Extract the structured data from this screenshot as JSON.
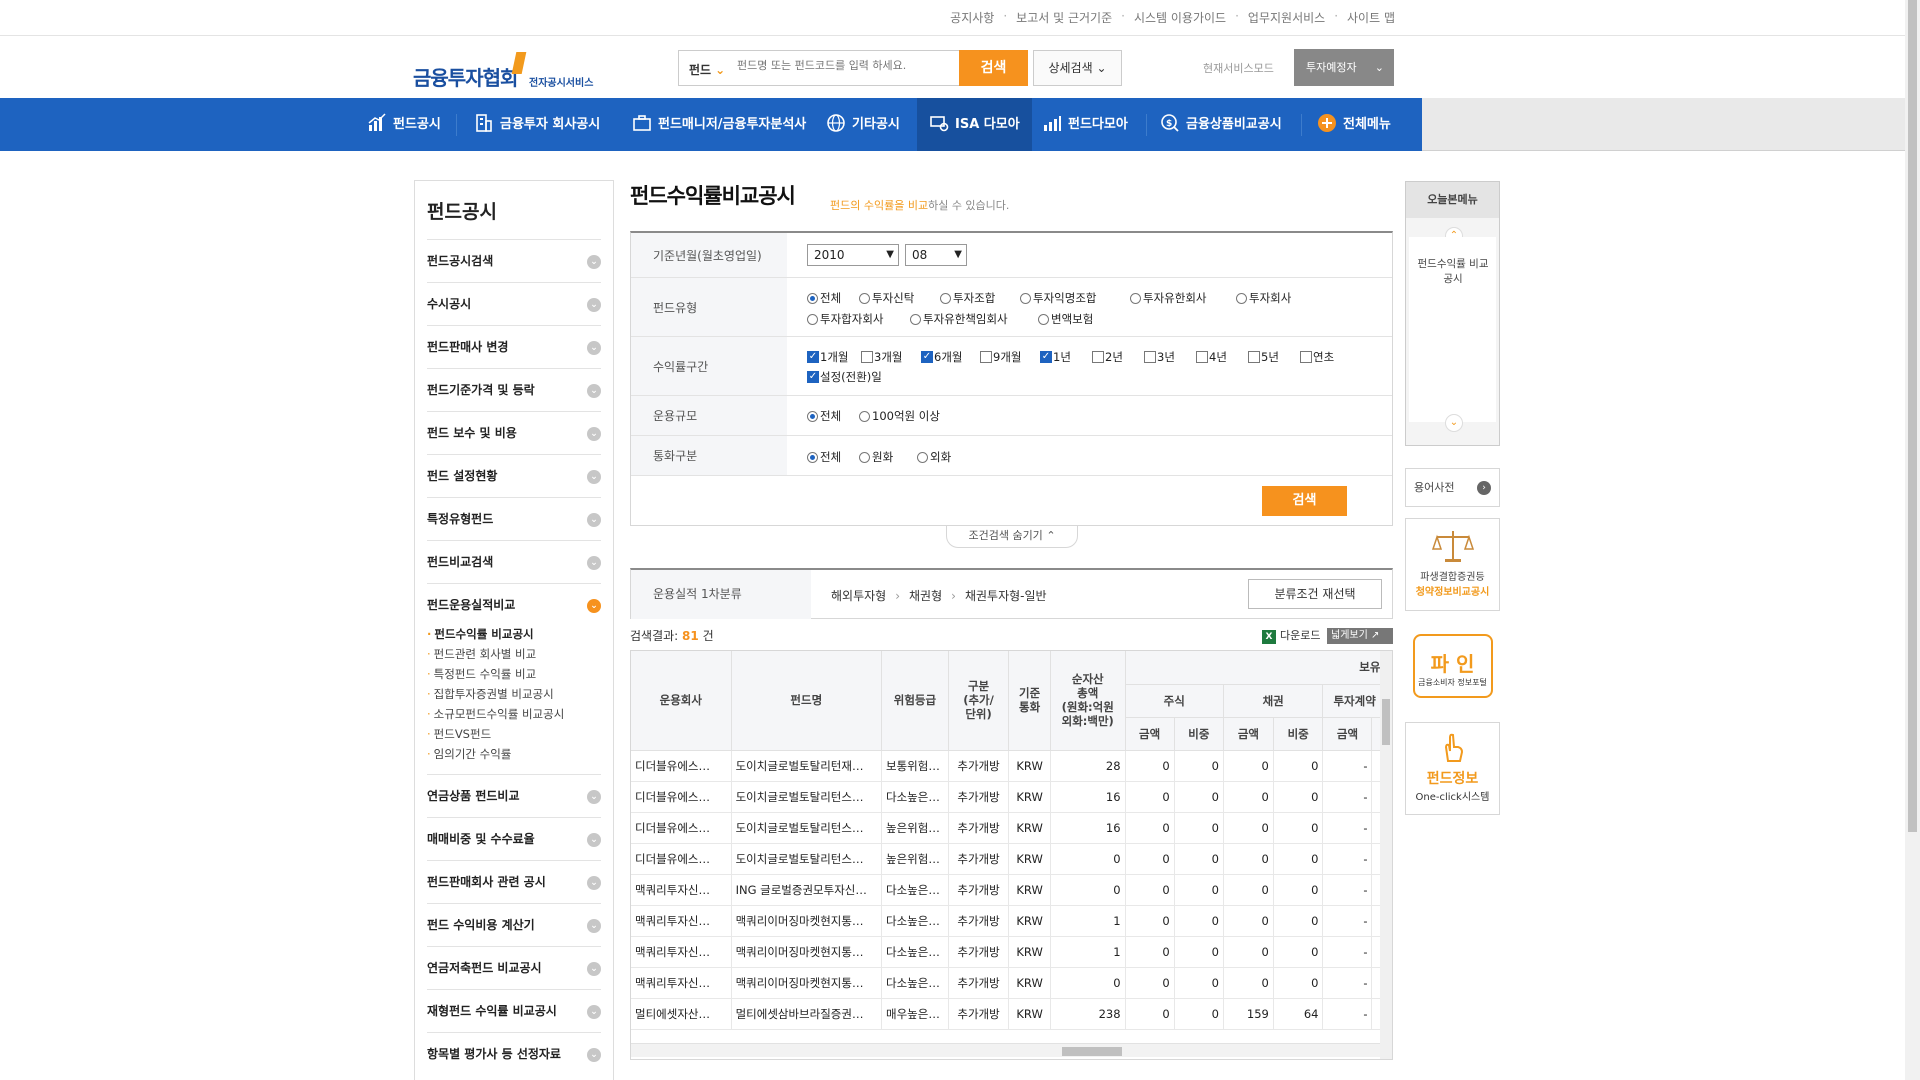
{
  "top_links": [
    "공지사항",
    "보고서 및 근거기준",
    "시스템 이용가이드",
    "업무지원서비스",
    "사이트 맵"
  ],
  "logo": {
    "title": "금융투자협회",
    "subtitle": "전자공시서비스"
  },
  "search": {
    "category": "펀드",
    "placeholder": "펀드명 또는 펀드코드를 입력 하세요.",
    "button": "검색",
    "detail": "상세검색"
  },
  "service_mode": {
    "label": "현재서비스모드",
    "value": "투자예정자"
  },
  "nav": [
    "펀드공시",
    "금융투자 회사공시",
    "펀드매니저/금융투자분석사",
    "기타공시",
    "ISA 다모아",
    "펀드다모아",
    "금융상품비교공시",
    "전체메뉴"
  ],
  "sidebar": {
    "title": "펀드공시",
    "items": [
      "펀드공시검색",
      "수시공시",
      "펀드판매사 변경",
      "펀드기준가격 및 등락",
      "펀드 보수 및 비용",
      "펀드 설정현황",
      "특정유형펀드",
      "펀드비교검색",
      "펀드운용실적비교",
      "연금상품 펀드비교",
      "매매비중 및 수수료율",
      "펀드판매회사 관련 공시",
      "펀드 수익비용 계산기",
      "연금저축펀드 비교공시",
      "재형펀드 수익률 비교공시",
      "항목별 평가사 등 선정자료"
    ],
    "sub_items": [
      "펀드수익률 비교공시",
      "펀드관련 회사별 비교",
      "특정펀드 수익률 비교",
      "집합투자증권별 비교공시",
      "소규모펀드수익률 비교공시",
      "펀드VS펀드",
      "임의기간 수익률"
    ]
  },
  "page": {
    "title": "펀드수익률비교공시",
    "subtitle_hl": "펀드의 수익률을 비교",
    "subtitle_rest": "하실 수 있습니다."
  },
  "form": {
    "base_date_label": "기준년월(월초영업일)",
    "year": "2010",
    "month": "08",
    "fund_type_label": "펀드유형",
    "fund_types": [
      "전체",
      "투자신탁",
      "투자조합",
      "투자익명조합",
      "투자유한회사",
      "투자회사",
      "투자합자회사",
      "투자유한책임회사",
      "변액보험"
    ],
    "period_label": "수익률구간",
    "periods": [
      "1개월",
      "3개월",
      "6개월",
      "9개월",
      "1년",
      "2년",
      "3년",
      "4년",
      "5년",
      "연초",
      "설정(전환)일"
    ],
    "size_label": "운용규모",
    "sizes": [
      "전체",
      "100억원 이상"
    ],
    "currency_label": "통화구분",
    "currencies": [
      "전체",
      "원화",
      "외화"
    ],
    "search_button": "검색",
    "hide_button": "조건검색 숨기기"
  },
  "category": {
    "label": "운용실적 1차분류",
    "path": [
      "해외투자형",
      "채권형",
      "채권투자형-일반"
    ],
    "reselect": "분류조건 재선택"
  },
  "results": {
    "label": "검색결과:",
    "count": "81",
    "unit": "건",
    "download": "다운로드",
    "wide": "넓게보기"
  },
  "table": {
    "headers": {
      "company": "운용회사",
      "fund": "펀드명",
      "risk": "위험등급",
      "kind": "구분\n(추가/\n단위)",
      "currency": "기준\n통화",
      "assets": "순자산\n총액\n(원화:억원\n외화:백만)",
      "holding": "보유자",
      "stock": "주식",
      "bond": "채권",
      "invest": "투자계약",
      "amount": "금액",
      "ratio": "비중"
    },
    "rows": [
      [
        "디더블유에스…",
        "도이치글로벌토탈리턴재…",
        "보통위험…",
        "추가개방",
        "KRW",
        "28",
        "0",
        "0",
        "0",
        "0",
        "-"
      ],
      [
        "디더블유에스…",
        "도이치글로벌토탈리턴스…",
        "다소높은…",
        "추가개방",
        "KRW",
        "16",
        "0",
        "0",
        "0",
        "0",
        "-"
      ],
      [
        "디더블유에스…",
        "도이치글로벌토탈리턴스…",
        "높은위험…",
        "추가개방",
        "KRW",
        "16",
        "0",
        "0",
        "0",
        "0",
        "-"
      ],
      [
        "디더블유에스…",
        "도이치글로벌토탈리턴스…",
        "높은위험…",
        "추가개방",
        "KRW",
        "0",
        "0",
        "0",
        "0",
        "0",
        "-"
      ],
      [
        "맥쿼리투자신…",
        "ING 글로벌증권모투자신…",
        "다소높은…",
        "추가개방",
        "KRW",
        "0",
        "0",
        "0",
        "0",
        "0",
        "-"
      ],
      [
        "맥쿼리투자신…",
        "맥쿼리이머징마켓현지통…",
        "다소높은…",
        "추가개방",
        "KRW",
        "1",
        "0",
        "0",
        "0",
        "0",
        "-"
      ],
      [
        "맥쿼리투자신…",
        "맥쿼리이머징마켓현지통…",
        "다소높은…",
        "추가개방",
        "KRW",
        "1",
        "0",
        "0",
        "0",
        "0",
        "-"
      ],
      [
        "맥쿼리투자신…",
        "맥쿼리이머징마켓현지통…",
        "다소높은…",
        "추가개방",
        "KRW",
        "0",
        "0",
        "0",
        "0",
        "0",
        "-"
      ],
      [
        "멀티에셋자산…",
        "멀티에셋삼바브라질증권…",
        "매우높은…",
        "추가개방",
        "KRW",
        "238",
        "0",
        "0",
        "159",
        "64",
        "-"
      ]
    ]
  },
  "right": {
    "today_title": "오늘본메뉴",
    "today_item": "펀드수익률 비교공시",
    "dict": "용어사전",
    "banner1_line1": "파생결합증권등",
    "banner1_line2": "청약정보비교공시",
    "banner2_main": "파 인",
    "banner2_sub": "금융소비자 정보포털",
    "banner3_main": "펀드정보",
    "banner3_sub": "One-click시스템"
  },
  "colors": {
    "nav": "#1e63c0",
    "accent": "#f6921e"
  }
}
